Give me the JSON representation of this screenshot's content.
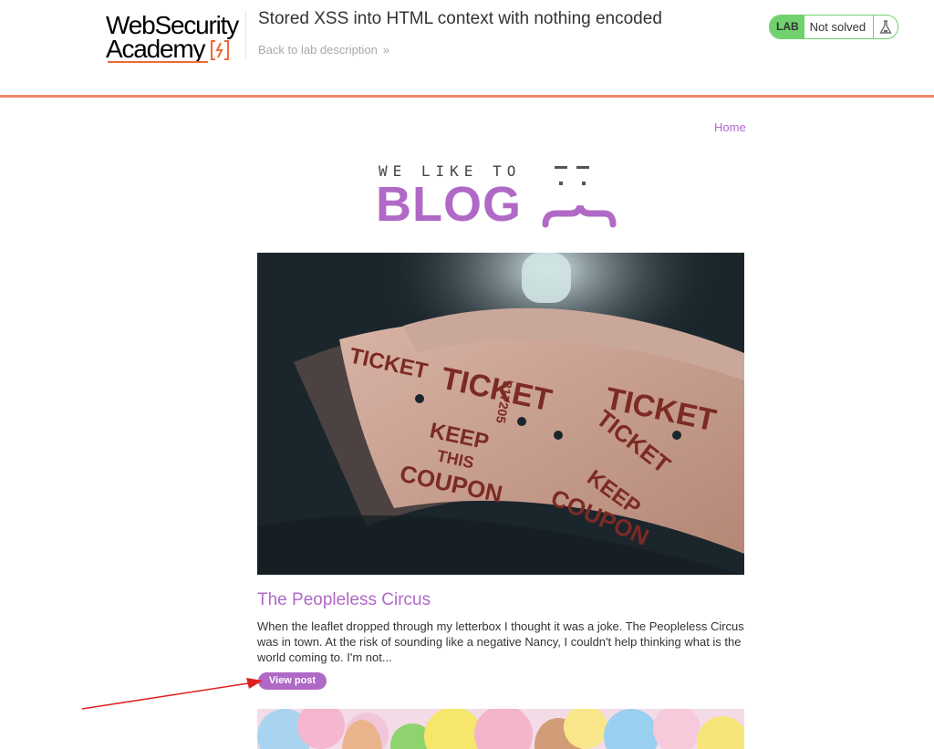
{
  "header": {
    "logo_line1": "WebSecurity",
    "logo_line2": "Academy",
    "lab_title": "Stored XSS into HTML context with nothing encoded",
    "back_link": "Back to lab description",
    "back_chevron": "»",
    "lab_badge": "LAB",
    "lab_status": "Not solved",
    "flask_icon": "flask-icon"
  },
  "nav": {
    "home": "Home"
  },
  "banner": {
    "small_text": "WE LIKE TO",
    "big_text": "BLOG"
  },
  "posts": [
    {
      "image_icon": "ticket-rolls-image",
      "title": "The Peopleless Circus",
      "excerpt": "When the leaflet dropped through my letterbox I thought it was a joke. The Peopleless Circus was in town. At the risk of sounding like a negative Nancy, I couldn't help thinking what is the world coming to. I'm not...",
      "button": "View post"
    },
    {
      "image_icon": "balloons-people-image"
    }
  ],
  "ticket_text": {
    "ticket": "TICKET",
    "keep": "KEEP",
    "this": "THIS",
    "coupon": "COUPON",
    "serial": "817205"
  },
  "colors": {
    "accent": "#b069c6",
    "header_rule": "#ee8a65",
    "lab_green": "#70d16d",
    "arrow": "#e02020"
  }
}
